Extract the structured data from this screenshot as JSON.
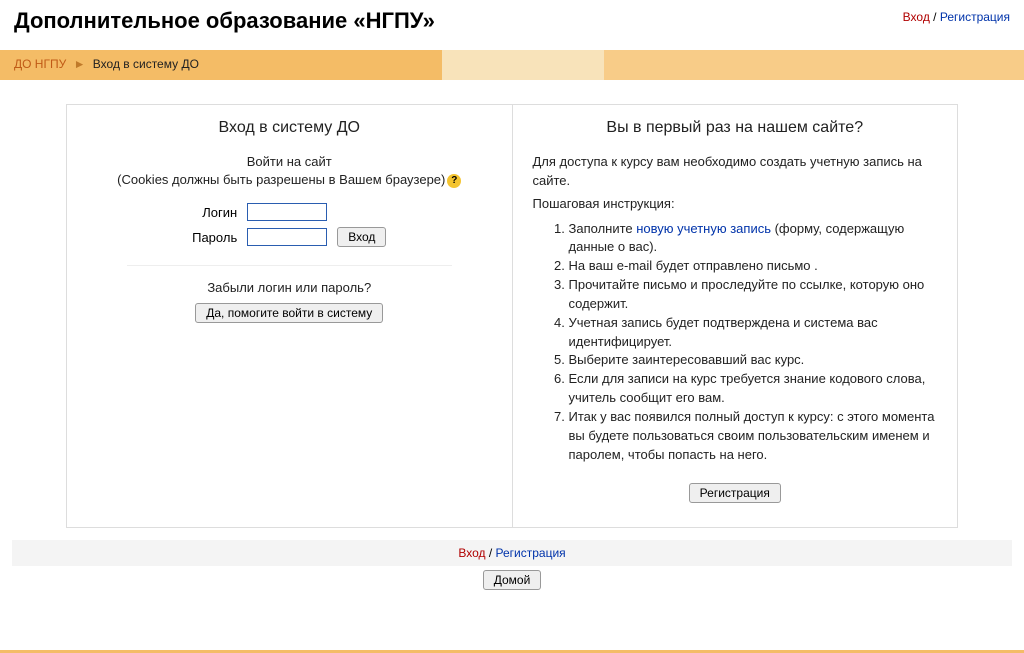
{
  "header": {
    "title": "Дополнительное образование «НГПУ»",
    "login": "Вход",
    "sep": " / ",
    "register": "Регистрация"
  },
  "breadcrumb": {
    "root": "ДО НГПУ",
    "arrow": "►",
    "current": "Вход в систему ДО"
  },
  "left": {
    "heading": "Вход в систему ДО",
    "intro_line1": "Войти на сайт",
    "intro_line2": "(Cookies должны быть разрешены в Вашем браузере)",
    "help_icon": "?",
    "login_label": "Логин",
    "password_label": "Пароль",
    "submit": "Вход",
    "forgot": "Забыли логин или пароль?",
    "help_button": "Да, помогите войти в систему"
  },
  "right": {
    "heading": "Вы в первый раз на нашем сайте?",
    "p1": "Для доступа к курсу вам необходимо создать учетную запись на сайте.",
    "p2": "Пошаговая инструкция:",
    "li1_a": "Заполните ",
    "li1_link": "новую учетную запись",
    "li1_b": " (форму, содержащую данные о вас).",
    "li2": "На ваш e-mail будет отправлено письмо .",
    "li3": "Прочитайте письмо и проследуйте по ссылке, которую оно содержит.",
    "li4": "Учетная запись будет подтверждена и система вас идентифицирует.",
    "li5": "Выберите заинтересовавший вас курс.",
    "li6": "Если для записи на курс требуется знание кодового слова, учитель сообщит его вам.",
    "li7": "Итак у вас появился полный доступ к курсу: с этого момента вы будете пользоваться своим пользовательским именем и паролем, чтобы попасть на него.",
    "register_button": "Регистрация"
  },
  "footer": {
    "login": "Вход",
    "sep": " / ",
    "register": "Регистрация",
    "home": "Домой"
  }
}
